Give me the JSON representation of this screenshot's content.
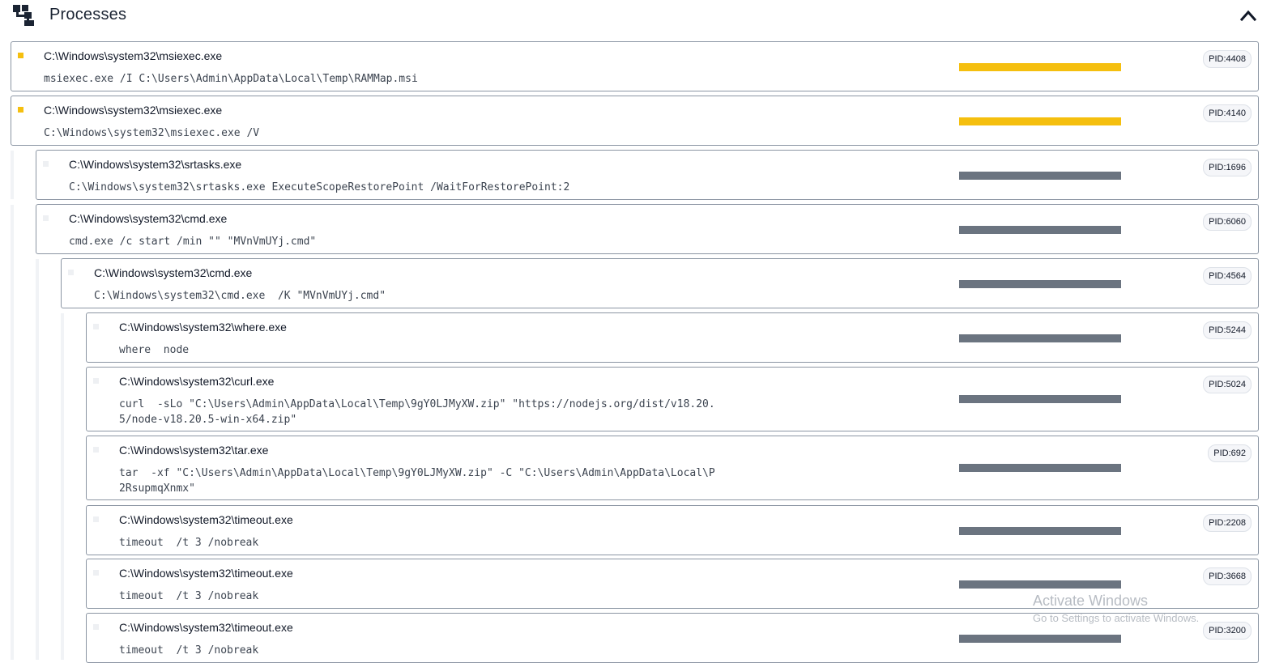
{
  "header": {
    "title": "Processes",
    "tree_icon": "process-tree-icon",
    "collapse_icon": "chevron-up-icon"
  },
  "colors": {
    "accent_yellow": "#f5bf0f",
    "bar_gray": "#6b7480",
    "border": "#8b95a3"
  },
  "processes": [
    {
      "path": "C:\\Windows\\system32\\msiexec.exe",
      "cmd": "msiexec.exe /I C:\\Users\\Admin\\AppData\\Local\\Temp\\RAMMap.msi",
      "pid": "PID:4408",
      "status": "highlighted"
    },
    {
      "path": "C:\\Windows\\system32\\msiexec.exe",
      "cmd": "C:\\Windows\\system32\\msiexec.exe /V",
      "pid": "PID:4140",
      "status": "highlighted"
    },
    {
      "path": "C:\\Windows\\system32\\srtasks.exe",
      "cmd": "C:\\Windows\\system32\\srtasks.exe ExecuteScopeRestorePoint /WaitForRestorePoint:2",
      "pid": "PID:1696",
      "status": "normal"
    },
    {
      "path": "C:\\Windows\\system32\\cmd.exe",
      "cmd": "cmd.exe /c start /min \"\" \"MVnVmUYj.cmd\"",
      "pid": "PID:6060",
      "status": "normal"
    },
    {
      "path": "C:\\Windows\\system32\\cmd.exe",
      "cmd": "C:\\Windows\\system32\\cmd.exe  /K \"MVnVmUYj.cmd\"",
      "pid": "PID:4564",
      "status": "normal"
    },
    {
      "path": "C:\\Windows\\system32\\where.exe",
      "cmd": "where  node",
      "pid": "PID:5244",
      "status": "normal"
    },
    {
      "path": "C:\\Windows\\system32\\curl.exe",
      "cmd": "curl  -sLo \"C:\\Users\\Admin\\AppData\\Local\\Temp\\9gY0LJMyXW.zip\" \"https://nodejs.org/dist/v18.20.\n5/node-v18.20.5-win-x64.zip\"",
      "pid": "PID:5024",
      "status": "normal"
    },
    {
      "path": "C:\\Windows\\system32\\tar.exe",
      "cmd": "tar  -xf \"C:\\Users\\Admin\\AppData\\Local\\Temp\\9gY0LJMyXW.zip\" -C \"C:\\Users\\Admin\\AppData\\Local\\P\n2RsupmqXnmx\"",
      "pid": "PID:692",
      "status": "normal"
    },
    {
      "path": "C:\\Windows\\system32\\timeout.exe",
      "cmd": "timeout  /t 3 /nobreak",
      "pid": "PID:2208",
      "status": "normal"
    },
    {
      "path": "C:\\Windows\\system32\\timeout.exe",
      "cmd": "timeout  /t 3 /nobreak",
      "pid": "PID:3668",
      "status": "normal"
    },
    {
      "path": "C:\\Windows\\system32\\timeout.exe",
      "cmd": "timeout  /t 3 /nobreak",
      "pid": "PID:3200",
      "status": "normal"
    }
  ],
  "watermark": {
    "line1": "Activate Windows",
    "line2": "Go to Settings to activate Windows."
  }
}
